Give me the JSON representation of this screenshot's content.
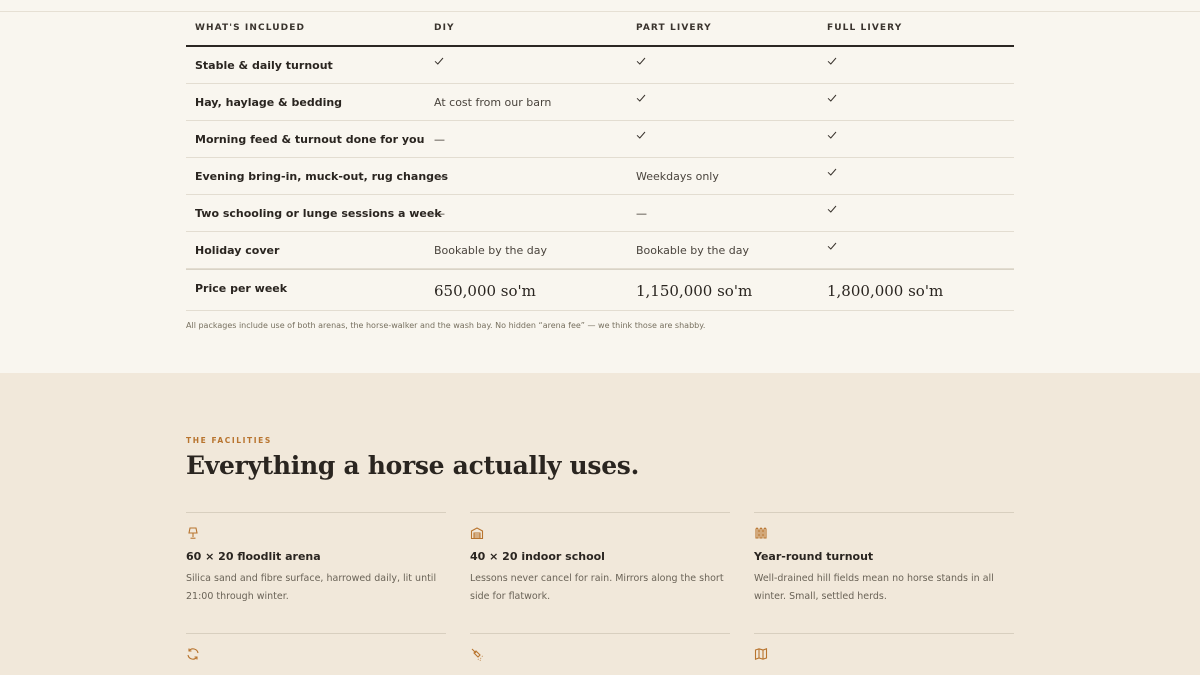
{
  "table": {
    "headers": [
      "WHAT'S INCLUDED",
      "DIY",
      "PART LIVERY",
      "FULL LIVERY"
    ],
    "rows": [
      {
        "label": "Stable & daily turnout",
        "diy": "check",
        "part": "check",
        "full": "check"
      },
      {
        "label": "Hay, haylage & bedding",
        "diy": "At cost from our barn",
        "part": "check",
        "full": "check"
      },
      {
        "label": "Morning feed & turnout done for you",
        "diy": "—",
        "part": "check",
        "full": "check"
      },
      {
        "label": "Evening bring-in, muck-out, rug changes",
        "diy": "—",
        "part": "Weekdays only",
        "full": "check"
      },
      {
        "label": "Two schooling or lunge sessions a week",
        "diy": "—",
        "part": "—",
        "full": "check"
      },
      {
        "label": "Holiday cover",
        "diy": "Bookable by the day",
        "part": "Bookable by the day",
        "full": "check"
      }
    ],
    "price": {
      "label": "Price per week",
      "diy": "650,000 so'm",
      "part": "1,150,000 so'm",
      "full": "1,800,000 so'm"
    },
    "note": "All packages include use of both arenas, the horse-walker and the wash bay. No hidden “arena fee” — we think those are shabby."
  },
  "facilities": {
    "eyebrow": "THE FACILITIES",
    "title": "Everything a horse actually uses.",
    "cards": [
      {
        "icon": "lamp-icon",
        "title": "60 × 20 floodlit arena",
        "desc": "Silica sand and fibre surface, harrowed daily, lit until 21:00 through winter."
      },
      {
        "icon": "warehouse-icon",
        "title": "40 × 20 indoor school",
        "desc": "Lessons never cancel for rain. Mirrors along the short side for flatwork."
      },
      {
        "icon": "fence-icon",
        "title": "Year-round turnout",
        "desc": "Well-drained hill fields mean no horse stands in all winter. Small, settled herds."
      },
      {
        "icon": "refresh-icon",
        "title": "",
        "desc": ""
      },
      {
        "icon": "shower-icon",
        "title": "",
        "desc": ""
      },
      {
        "icon": "map-icon",
        "title": "",
        "desc": ""
      }
    ]
  },
  "colors": {
    "accent": "#b8742e",
    "bg": "#f9f6ef",
    "section_bg": "#f1e8da",
    "text": "#2a2520"
  }
}
